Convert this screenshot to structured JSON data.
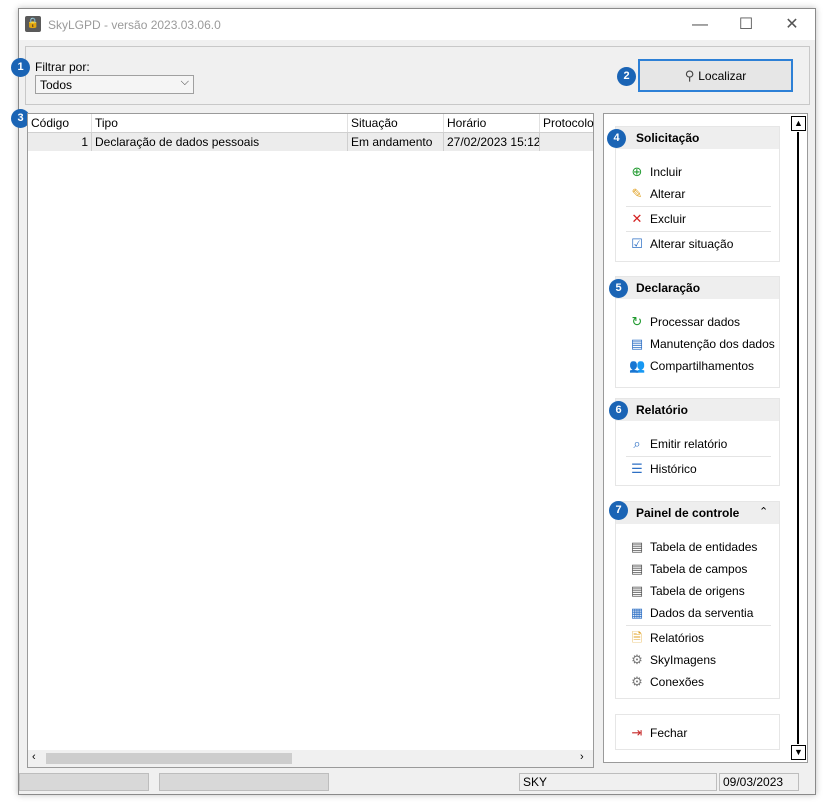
{
  "window": {
    "title": "SkyLGPD - versão 2023.03.06.0",
    "minimize": "—",
    "maximize": "☐",
    "close": "✕"
  },
  "filter": {
    "label": "Filtrar por:",
    "value": "Todos",
    "search_button": "Localizar"
  },
  "badges": [
    "1",
    "2",
    "3",
    "4",
    "5",
    "6",
    "7"
  ],
  "grid": {
    "columns": [
      "Código",
      "Tipo",
      "Situação",
      "Horário",
      "Protocolo"
    ],
    "rows": [
      {
        "codigo": "1",
        "tipo": "Declaração de dados pessoais",
        "situacao": "Em andamento",
        "horario": "27/02/2023 15:12",
        "protocolo": ""
      }
    ]
  },
  "panel": {
    "solicitacao": {
      "title": "Solicitação",
      "items": [
        "Incluir",
        "Alterar",
        "Excluir",
        "Alterar situação"
      ]
    },
    "declaracao": {
      "title": "Declaração",
      "items": [
        "Processar dados",
        "Manutenção dos dados",
        "Compartilhamentos"
      ]
    },
    "relatorio": {
      "title": "Relatório",
      "items": [
        "Emitir relatório",
        "Histórico"
      ]
    },
    "painel": {
      "title": "Painel de controle",
      "items": [
        "Tabela de entidades",
        "Tabela de campos",
        "Tabela de origens",
        "Dados da serventia",
        "Relatórios",
        "SkyImagens",
        "Conexões"
      ]
    },
    "fechar": "Fechar"
  },
  "statusbar": {
    "user": "SKY",
    "date": "09/03/2023"
  },
  "colors": {
    "badge": "#1a64b5",
    "focus_border": "#2d80d6"
  }
}
